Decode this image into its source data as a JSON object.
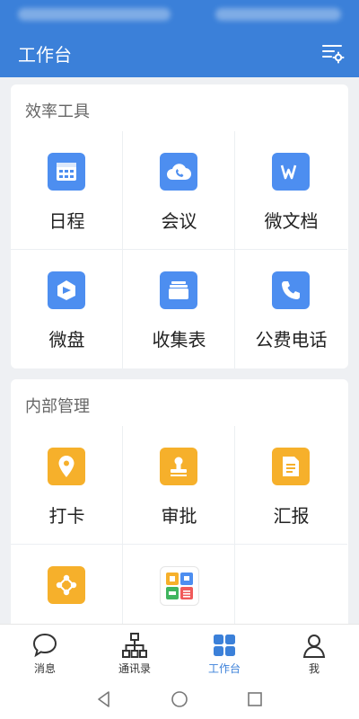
{
  "appbar": {
    "title": "工作台",
    "settings_icon": "settings-list-icon"
  },
  "sections": [
    {
      "title": "效率工具",
      "items": [
        {
          "label": "日程",
          "icon": "calendar-icon",
          "color": "#4d8ef0"
        },
        {
          "label": "会议",
          "icon": "cloud-phone-icon",
          "color": "#4d8ef0"
        },
        {
          "label": "微文档",
          "icon": "doc-w-icon",
          "color": "#4d8ef0"
        },
        {
          "label": "微盘",
          "icon": "drive-icon",
          "color": "#4d8ef0"
        },
        {
          "label": "收集表",
          "icon": "form-tray-icon",
          "color": "#4d8ef0"
        },
        {
          "label": "公费电话",
          "icon": "phone-icon",
          "color": "#4d8ef0"
        }
      ]
    },
    {
      "title": "内部管理",
      "items": [
        {
          "label": "打卡",
          "icon": "location-pin-icon",
          "color": "#f6b02b"
        },
        {
          "label": "审批",
          "icon": "stamp-icon",
          "color": "#f6b02b"
        },
        {
          "label": "汇报",
          "icon": "report-icon",
          "color": "#f6b02b"
        },
        {
          "label": "",
          "icon": "nodes-icon",
          "color": "#f6b02b"
        },
        {
          "label": "",
          "icon": "apps-grid-icon",
          "color": "#ffffff"
        }
      ]
    }
  ],
  "tabs": [
    {
      "label": "消息",
      "icon": "chat-bubble-icon"
    },
    {
      "label": "通讯录",
      "icon": "org-chart-icon"
    },
    {
      "label": "工作台",
      "icon": "workbench-grid-icon",
      "active": true
    },
    {
      "label": "我",
      "icon": "person-icon"
    }
  ],
  "colors": {
    "brand": "#3b80d9",
    "tool_blue": "#4d8ef0",
    "manage_yellow": "#f6b02b"
  }
}
